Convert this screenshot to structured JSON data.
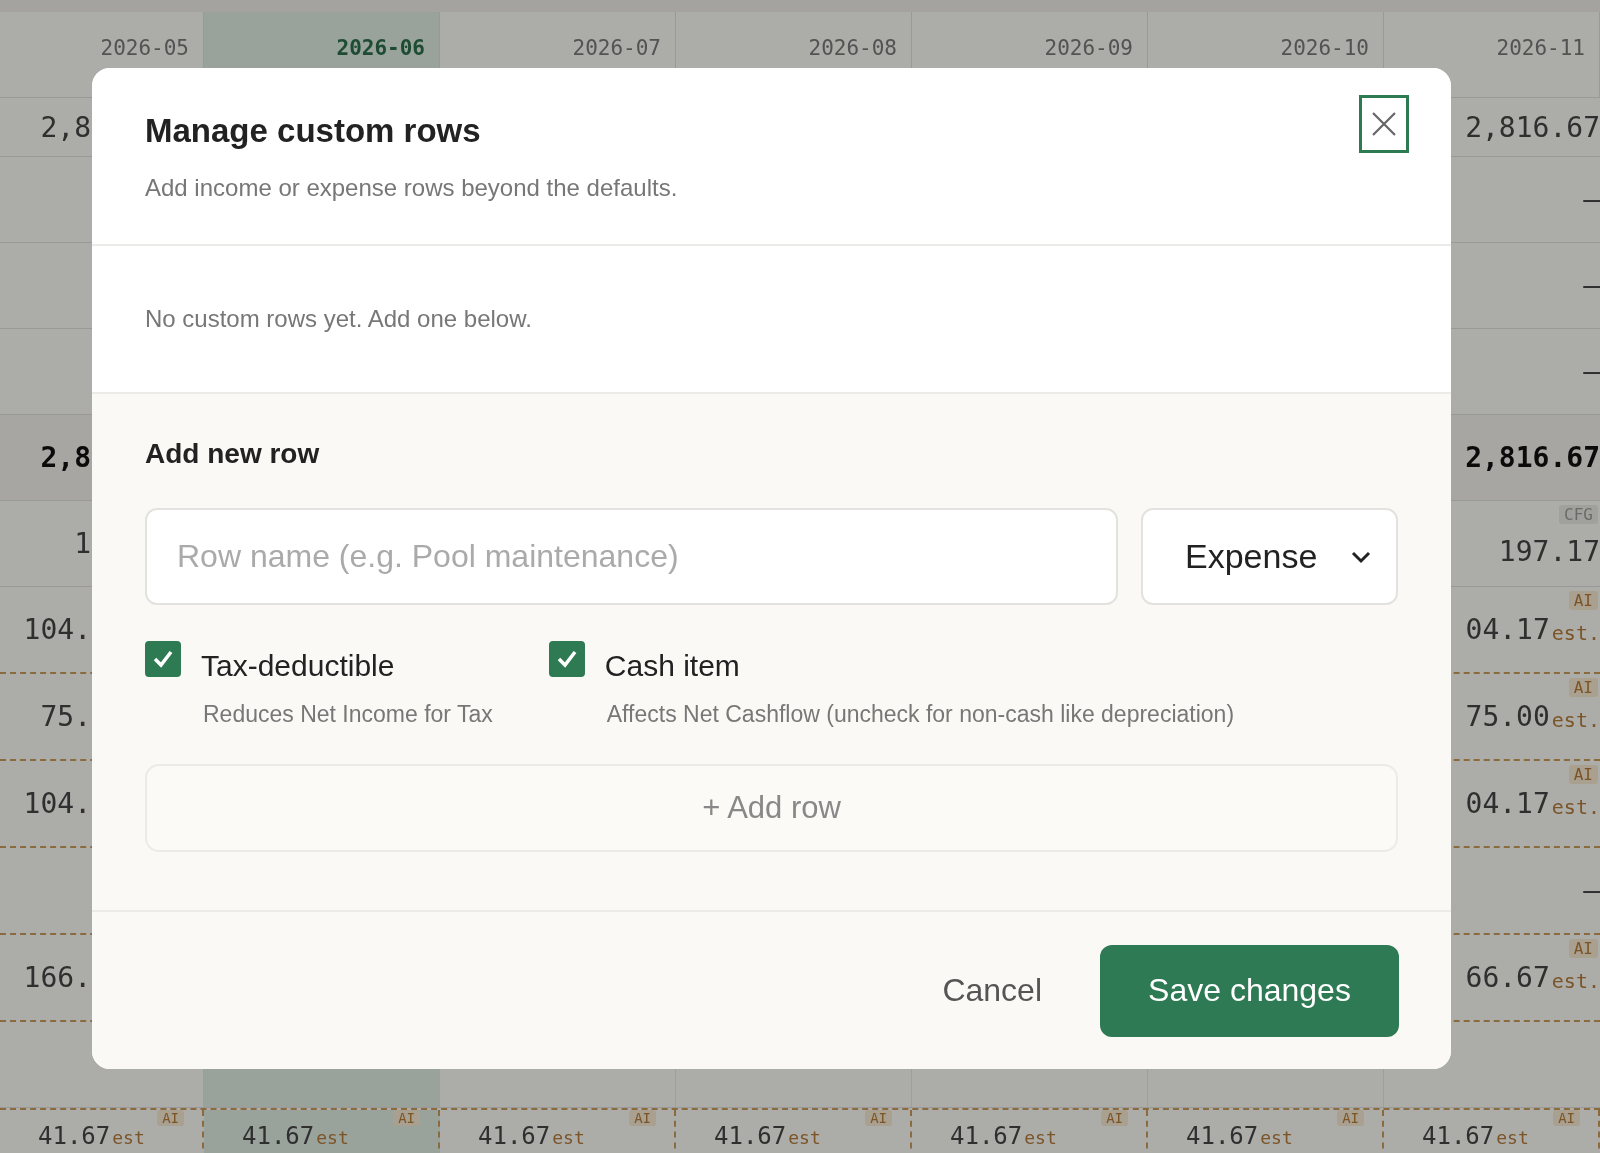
{
  "table": {
    "columns": [
      {
        "label": "2026-05",
        "selected": false
      },
      {
        "label": "2026-06",
        "selected": true
      },
      {
        "label": "2026-07",
        "selected": false
      },
      {
        "label": "2026-08",
        "selected": false
      },
      {
        "label": "2026-09",
        "selected": false
      },
      {
        "label": "2026-10",
        "selected": false
      },
      {
        "label": "2026-11",
        "selected": false
      }
    ],
    "rows": [
      {
        "kind": "value",
        "left": {
          "value": "2,8"
        },
        "right": {
          "value": "2,816.67"
        }
      },
      {
        "kind": "value",
        "right": {
          "value": "—"
        }
      },
      {
        "kind": "value",
        "right": {
          "value": "—"
        }
      },
      {
        "kind": "value",
        "right": {
          "value": "—"
        }
      },
      {
        "kind": "total",
        "left": {
          "value": "2,8"
        },
        "right": {
          "value": "2,816.67"
        }
      },
      {
        "kind": "config",
        "left": {
          "value": "1"
        },
        "right": {
          "value": "197.17",
          "badge": "CFG"
        }
      },
      {
        "kind": "estimate",
        "left": {
          "value": "104."
        },
        "right": {
          "value": "04.17",
          "suffix": "est.",
          "badge": "AI"
        }
      },
      {
        "kind": "estimate",
        "left": {
          "value": "75."
        },
        "right": {
          "value": "75.00",
          "suffix": "est.",
          "badge": "AI"
        }
      },
      {
        "kind": "estimate",
        "left": {
          "value": "104."
        },
        "right": {
          "value": "04.17",
          "suffix": "est.",
          "badge": "AI"
        }
      },
      {
        "kind": "estimate",
        "right": {
          "value": "—"
        }
      },
      {
        "kind": "estimate",
        "left": {
          "value": "166."
        },
        "right": {
          "value": "66.67",
          "suffix": "est.",
          "badge": "AI"
        }
      },
      {
        "kind": "value"
      }
    ],
    "last_row": [
      {
        "value": "41.67",
        "suffix": "est",
        "badge": "AI"
      },
      {
        "value": "41.67",
        "suffix": "est",
        "badge": "AI"
      },
      {
        "value": "41.67",
        "suffix": "est",
        "badge": "AI"
      },
      {
        "value": "41.67",
        "suffix": "est",
        "badge": "AI"
      },
      {
        "value": "41.67",
        "suffix": "est",
        "badge": "AI"
      },
      {
        "value": "41.67",
        "suffix": "est",
        "badge": "AI"
      },
      {
        "value": "41.67",
        "suffix": "est",
        "badge": "AI"
      }
    ]
  },
  "dialog": {
    "title": "Manage custom rows",
    "subtitle": "Add income or expense rows beyond the defaults.",
    "empty_message": "No custom rows yet. Add one below.",
    "section_title": "Add new row",
    "name_field": {
      "placeholder": "Row name (e.g. Pool maintenance)"
    },
    "type_select": {
      "value": "Expense"
    },
    "options": [
      {
        "label": "Tax-deductible",
        "hint": "Reduces Net Income for Tax",
        "checked": true
      },
      {
        "label": "Cash item",
        "hint": "Affects Net Cashflow (uncheck for non-cash like depreciation)",
        "checked": true
      }
    ],
    "add_button": "+ Add row",
    "cancel": "Cancel",
    "save": "Save changes"
  }
}
